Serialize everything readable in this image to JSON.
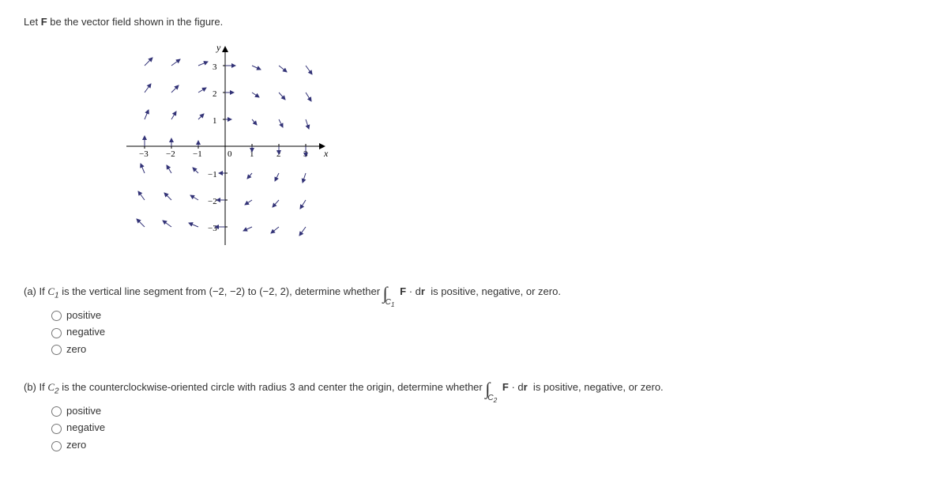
{
  "prompt": "Let F be the vector field shown in the figure.",
  "chart_data": {
    "type": "vector_field",
    "xlabel": "x",
    "ylabel": "y",
    "xlim": [
      -3,
      3
    ],
    "ylim": [
      -3,
      3
    ],
    "xticks": [
      -3,
      -2,
      -1,
      0,
      1,
      2,
      3
    ],
    "yticks": [
      -3,
      -2,
      -1,
      1,
      2,
      3
    ],
    "description": "Rotational field pattern suggesting clockwise circulation around origin; arrows on left side point upward, right side point downward, top points rightward, bottom points leftward (approximate)."
  },
  "questions": {
    "a": {
      "label": "(a) If ",
      "curve": "C₁",
      "text1": " is the vertical line segment from  (−2, −2) to (−2, 2),  determine whether  ",
      "integral_sub": "C₁",
      "text2": " F · dr  is positive, negative, or zero.",
      "options": [
        "positive",
        "negative",
        "zero"
      ]
    },
    "b": {
      "label": "(b) If ",
      "curve": "C₂",
      "text1": " is the counterclockwise-oriented circle with radius 3 and center the origin, determine whether  ",
      "integral_sub": "C₂",
      "text2": " F · dr  is positive, negative, or zero.",
      "options": [
        "positive",
        "negative",
        "zero"
      ]
    }
  }
}
